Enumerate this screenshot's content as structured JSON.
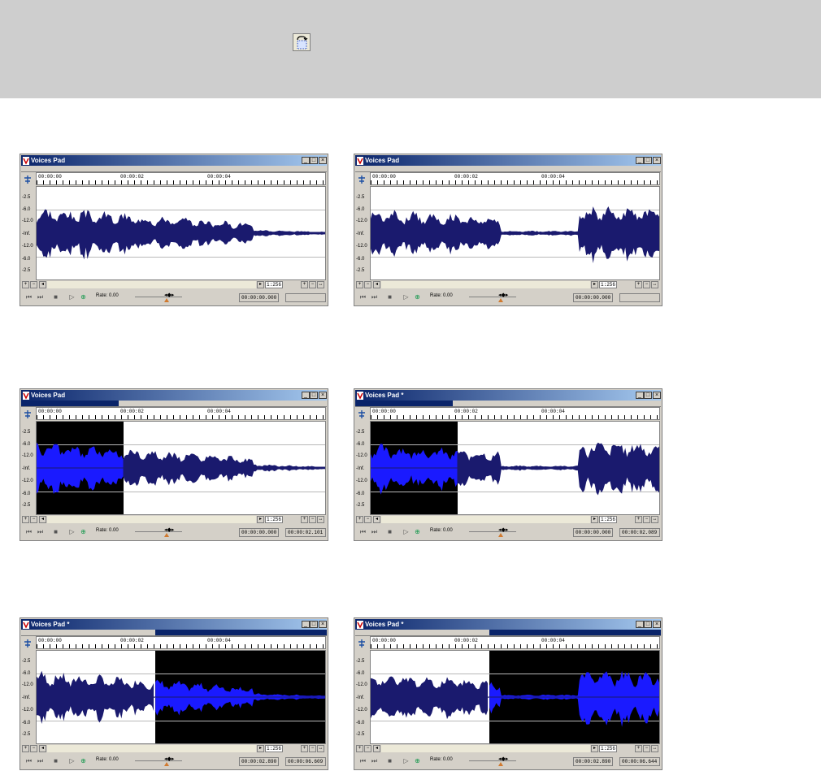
{
  "loop_button_icon": "loop-selection-icon",
  "window_template": {
    "ruler_labels": [
      "00:00:00",
      "00:00:02",
      "00:00:04"
    ],
    "db_scale": [
      "-2.5",
      "-6.0",
      "-12.0",
      "-Inf.",
      "-12.0",
      "-6.0",
      "-2.5"
    ],
    "rate_label": "Rate: 0.00",
    "zoom_label": "1:256",
    "transport_icons": [
      "go-to-start-icon",
      "go-to-end-icon",
      "stop-icon",
      "play-icon",
      "loop-icon"
    ]
  },
  "windows": [
    {
      "title": "Voices Pad",
      "time_start": "00:00:00.000",
      "time_end": "",
      "progress": 0,
      "selection": null,
      "selection_color": "#1a1aff"
    },
    {
      "title": "Voices Pad",
      "time_start": "00:00:00.000",
      "time_end": "",
      "progress": 0,
      "selection": null,
      "selection_color": "#1a1aff"
    },
    {
      "title": "Voices Pad",
      "time_start": "00:00:00.000",
      "time_end": "00:00:02.101",
      "progress": 0.32,
      "selection": [
        0,
        0.3
      ],
      "selection_color": "#1a1aff"
    },
    {
      "title": "Voices Pad *",
      "time_start": "00:00:00.000",
      "time_end": "00:00:02.089",
      "progress": 0.32,
      "selection": [
        0,
        0.3
      ],
      "selection_color": "#1a1aff"
    },
    {
      "title": "Voices Pad *",
      "time_start": "00:00:02.890",
      "time_end": "00:00:06.609",
      "progress": 0.44,
      "selection": [
        0.41,
        1
      ],
      "selection_color": "#1a1aff"
    },
    {
      "title": "Voices Pad *",
      "time_start": "00:00:02.890",
      "time_end": "00:00:06.644",
      "progress": 0.44,
      "selection": [
        0.41,
        1
      ],
      "selection_color": "#1a1aff"
    }
  ],
  "colors": {
    "wave": "#1a1a6e",
    "wave_selected": "#1a1aff",
    "title_bar": "#0a246a"
  }
}
